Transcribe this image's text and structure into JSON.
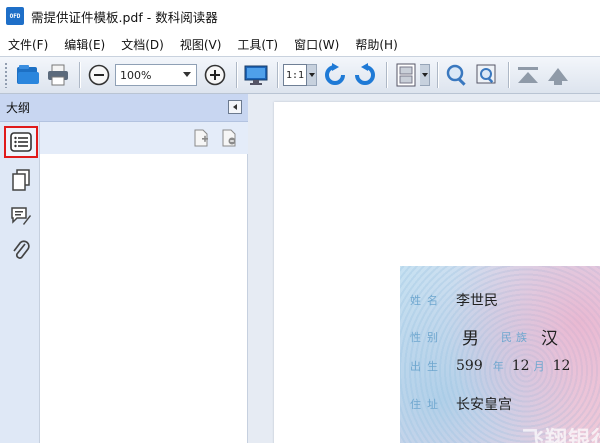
{
  "window": {
    "title": "需提供证件模板.pdf - 数科阅读器",
    "app_icon_label": "OFD"
  },
  "menu": [
    {
      "label": "文件(F)"
    },
    {
      "label": "编辑(E)"
    },
    {
      "label": "文档(D)"
    },
    {
      "label": "视图(V)"
    },
    {
      "label": "工具(T)"
    },
    {
      "label": "窗口(W)"
    },
    {
      "label": "帮助(H)"
    }
  ],
  "toolbar": {
    "zoom_value": "100%",
    "ratio_label": "1:1",
    "icons": [
      "open-icon",
      "print-icon",
      "zoom-out-icon",
      "zoom-in-icon",
      "fullscreen-icon",
      "rotate-left-icon",
      "rotate-right-icon",
      "page-layout-icon",
      "search-icon",
      "zoom-tool-icon",
      "first-page-icon",
      "previous-page-icon"
    ]
  },
  "panel": {
    "title": "大纲"
  },
  "sidebar_icons": [
    "outline-icon",
    "pages-icon",
    "annotations-icon",
    "attachments-icon"
  ],
  "document": {
    "card": {
      "name_label": "姓名",
      "name_value": "李世民",
      "gender_label": "性别",
      "gender_value": "男",
      "ethnicity_label": "民族",
      "ethnicity_value": "汉",
      "birth_label": "出生",
      "birth_year": "599",
      "year_label": "年",
      "birth_month": "12",
      "month_label": "月",
      "birth_day": "12",
      "address_label": "住址",
      "address_value": "长安皇宫"
    },
    "watermark": "飞翔银行"
  },
  "colors": {
    "accent": "#1e6fc8",
    "highlight": "#e01a1a",
    "panel_header": "#c8d6f1"
  }
}
